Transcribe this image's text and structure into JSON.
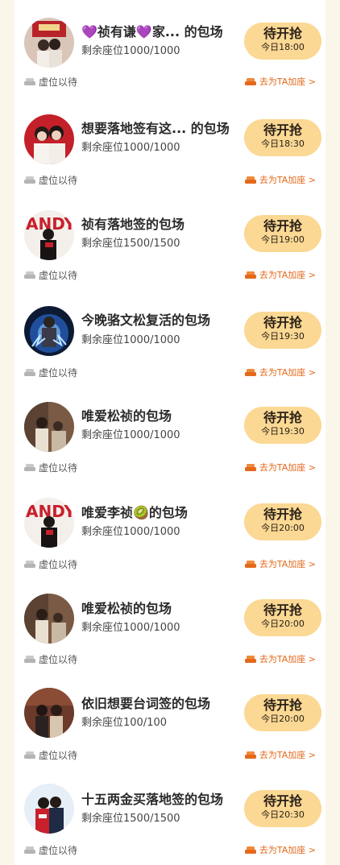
{
  "common": {
    "grab_label": "待开抢",
    "waiting_label": "虚位以待",
    "add_seat_label": "去为TA加座 >"
  },
  "items": [
    {
      "title": "💜祯有谦💜家...  的包场",
      "seats": "剩余座位1000/1000",
      "time": "今日18:00"
    },
    {
      "title": "想要落地签有这... 的包场",
      "seats": "剩余座位1000/1000",
      "time": "今日18:30"
    },
    {
      "title": "祯有落地签的包场",
      "seats": "剩余座位1500/1500",
      "time": "今日19:00"
    },
    {
      "title": "今晚骆文松复活的包场",
      "seats": "剩余座位1000/1000",
      "time": "今日19:30"
    },
    {
      "title": "唯爱松祯的包场",
      "seats": "剩余座位1000/1000",
      "time": "今日19:30"
    },
    {
      "title": "唯爱李祯🥝的包场",
      "seats": "剩余座位1000/1000",
      "time": "今日20:00"
    },
    {
      "title": "唯爱松祯的包场",
      "seats": "剩余座位1000/1000",
      "time": "今日20:00"
    },
    {
      "title": "依旧想要台词签的包场",
      "seats": "剩余座位100/100",
      "time": "今日20:00"
    },
    {
      "title": "十五两金买落地签的包场",
      "seats": "剩余座位1500/1500",
      "time": "今日20:30"
    }
  ]
}
